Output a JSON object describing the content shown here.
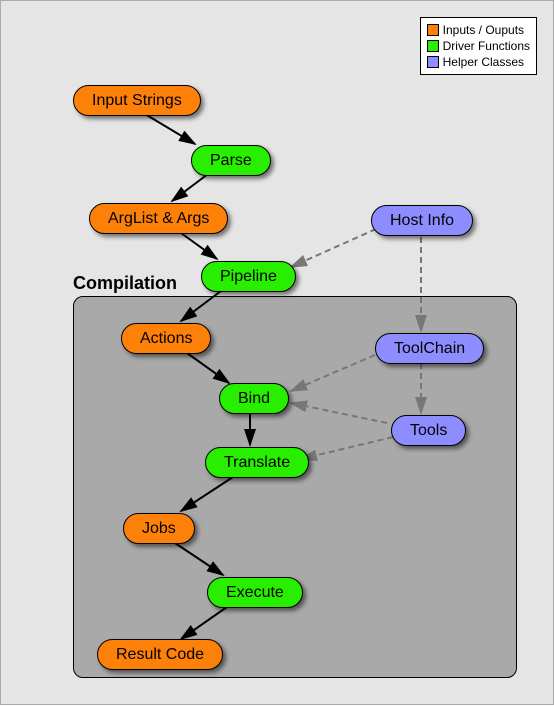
{
  "legend": {
    "inputs_outputs": "Inputs / Ouputs",
    "driver_functions": "Driver Functions",
    "helper_classes": "Helper Classes"
  },
  "group": {
    "label": "Compilation"
  },
  "nodes": {
    "input_strings": "Input Strings",
    "parse": "Parse",
    "arglist_args": "ArgList & Args",
    "pipeline": "Pipeline",
    "host_info": "Host Info",
    "actions": "Actions",
    "bind": "Bind",
    "toolchain": "ToolChain",
    "tools": "Tools",
    "translate": "Translate",
    "jobs": "Jobs",
    "execute": "Execute",
    "result_code": "Result Code"
  },
  "colors": {
    "inputs_outputs": "#fd8008",
    "driver_functions": "#28ef00",
    "helper_classes": "#8d8dff"
  }
}
